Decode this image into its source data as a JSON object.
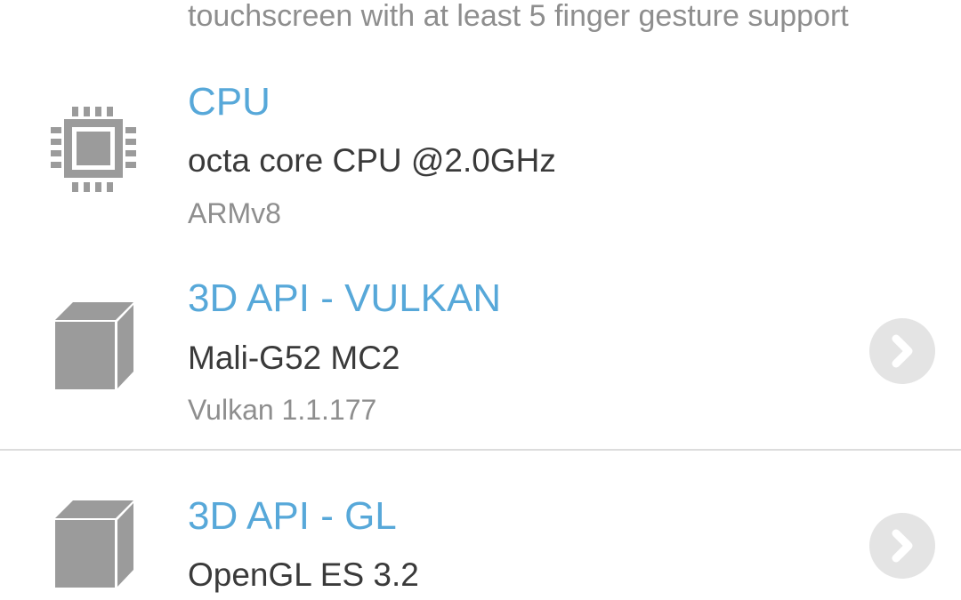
{
  "top_item": {
    "detail": "touchscreen with at least 5 finger gesture support"
  },
  "cpu": {
    "icon": "cpu-chip-icon",
    "title": "CPU",
    "value": "octa core CPU @2.0GHz",
    "detail": "ARMv8"
  },
  "vulkan": {
    "icon": "cube-3d-icon",
    "title": "3D API - VULKAN",
    "value": "Mali-G52 MC2",
    "detail": "Vulkan 1.1.177",
    "action_icon": "chevron-right-icon"
  },
  "gl": {
    "icon": "cube-3d-icon",
    "title": "3D API - GL",
    "value": "OpenGL ES 3.2",
    "action_icon": "chevron-right-icon"
  },
  "colors": {
    "title_blue": "#57a8d9",
    "value_dark": "#3a3a3a",
    "detail_gray": "#8e8e8e",
    "icon_gray": "#9b9b9b",
    "chevron_bg": "#e4e4e4"
  }
}
